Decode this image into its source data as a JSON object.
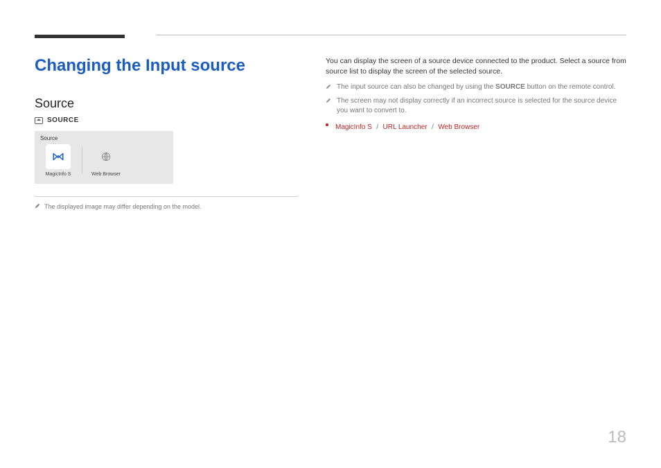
{
  "title": "Changing the Input source",
  "left": {
    "subhead": "Source",
    "sourceBtn": "SOURCE",
    "panelTitle": "Source",
    "items": [
      {
        "label": "MagicInfo S"
      },
      {
        "label": "Web Browser"
      }
    ],
    "note": "The displayed image may differ depending on the model."
  },
  "right": {
    "intro": "You can display the screen of a source device connected to the product. Select a source from source list to display the screen of the selected source.",
    "note1_pre": "The input source can also be changed by using the ",
    "note1_bold": "SOURCE",
    "note1_post": " button on the remote control.",
    "note2": "The screen may not display correctly if an incorrect source is selected for the source device you want to convert to.",
    "links": [
      "MagicInfo S",
      "URL Launcher",
      "Web Browser"
    ],
    "sep": "/"
  },
  "pageNumber": "18"
}
